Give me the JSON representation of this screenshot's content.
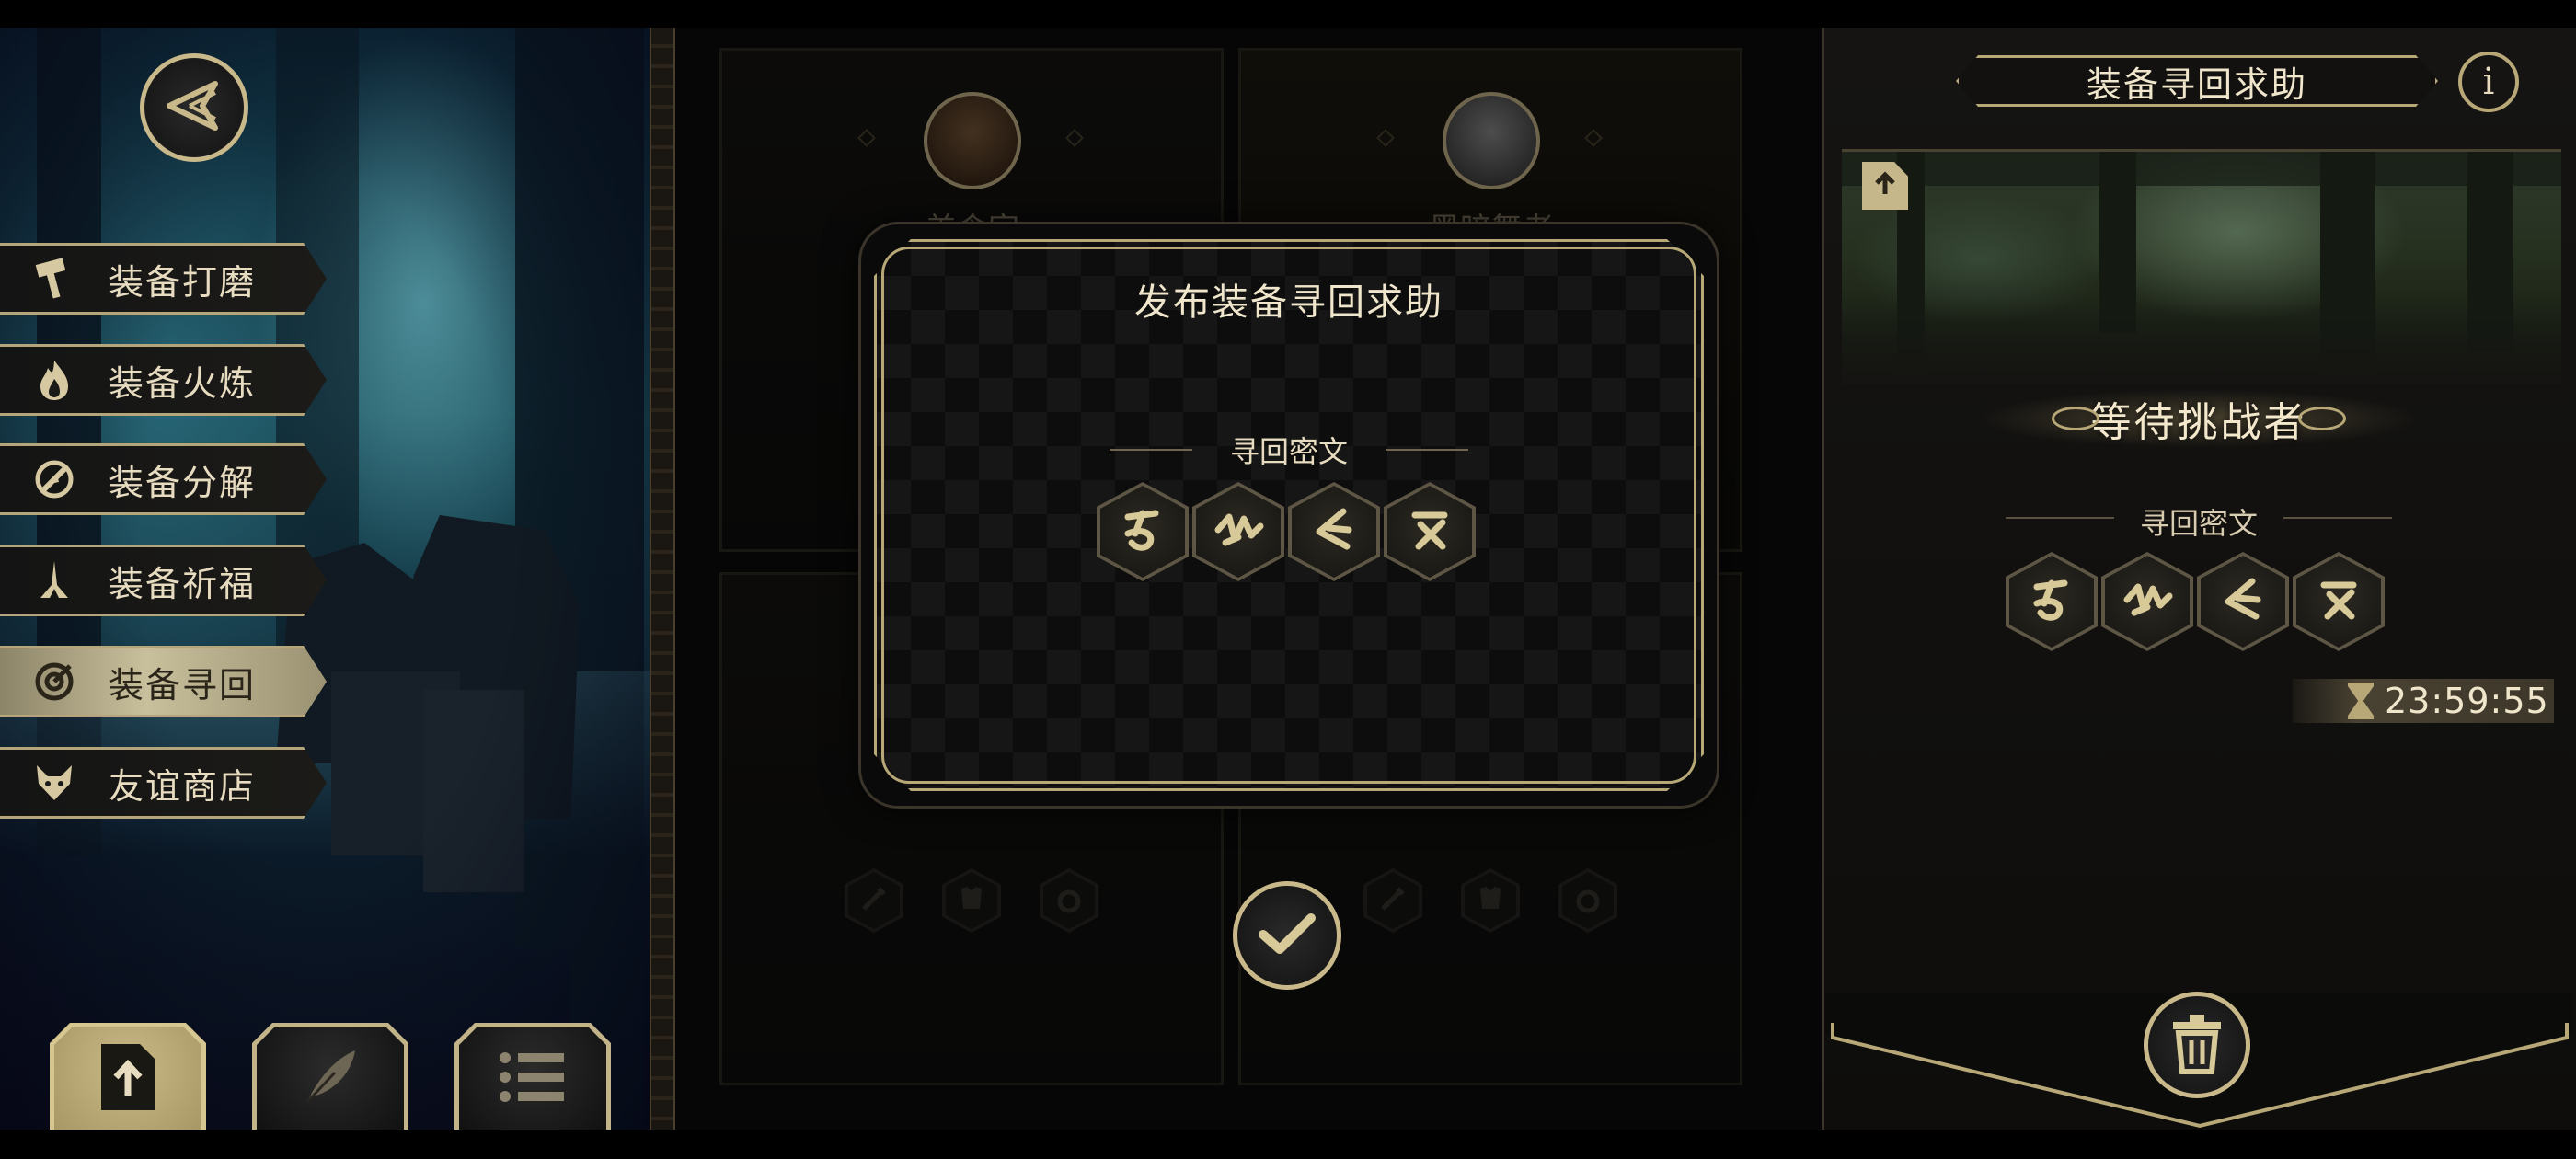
{
  "colors": {
    "gold": "#c9b98a",
    "panel_dark": "#0d0d0d",
    "active_tab": "#c8bf9c",
    "text_light": "#e8dcc0"
  },
  "sidebar": {
    "back_icon": "back-arrow-icon",
    "items": [
      {
        "label": "装备打磨",
        "icon": "hammer-icon",
        "active": false
      },
      {
        "label": "装备火炼",
        "icon": "flame-icon",
        "active": false
      },
      {
        "label": "装备分解",
        "icon": "disassemble-icon",
        "active": false
      },
      {
        "label": "装备祈福",
        "icon": "praying-hands-icon",
        "active": false
      },
      {
        "label": "装备寻回",
        "icon": "target-icon",
        "active": true
      },
      {
        "label": "友谊商店",
        "icon": "fox-icon",
        "active": false
      }
    ],
    "bottom_buttons": [
      {
        "icon": "upload-file-icon",
        "active": true
      },
      {
        "icon": "feather-icon",
        "active": false
      },
      {
        "icon": "list-icon",
        "active": false
      }
    ]
  },
  "cards": [
    {
      "name": "美食家",
      "avatar": "wolf-avatar"
    },
    {
      "name": "黑暗舞者",
      "avatar": "mouse-avatar"
    }
  ],
  "modal": {
    "title": "发布装备寻回求助",
    "cipher_label": "寻回密文",
    "runes": [
      "rune-1",
      "rune-2",
      "rune-3",
      "rune-4"
    ],
    "confirm_icon": "checkmark-icon"
  },
  "right_panel": {
    "title": "装备寻回求助",
    "info_label": "i",
    "status": "等待挑战者",
    "cipher_label": "寻回密文",
    "runes": [
      "rune-1",
      "rune-2",
      "rune-3",
      "rune-4"
    ],
    "timer": "23:59:55",
    "delete_icon": "trash-icon"
  }
}
